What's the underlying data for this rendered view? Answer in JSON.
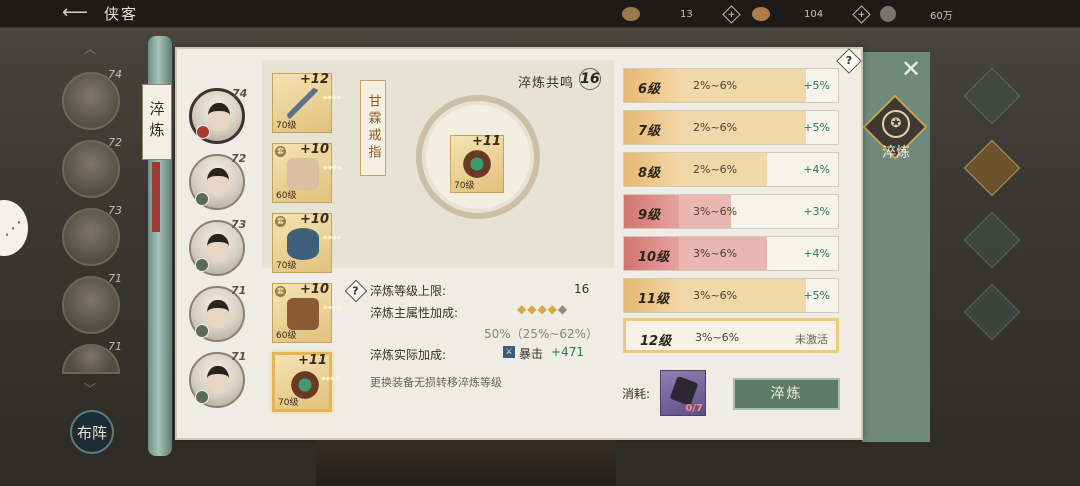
{
  "header": {
    "back_icon": "back-arrow-icon",
    "title": "侠客",
    "resources": [
      {
        "icon": "leaf-icon",
        "value": "13"
      },
      {
        "icon": "hat-icon",
        "value": "104"
      },
      {
        "icon": "coin-icon",
        "value": "60万"
      }
    ]
  },
  "side_tab": {
    "label": "淬炼"
  },
  "close_icon": "close-icon",
  "heroes": [
    {
      "level": "74",
      "selected": true
    },
    {
      "level": "72",
      "selected": false
    },
    {
      "level": "73",
      "selected": false
    },
    {
      "level": "71",
      "selected": false
    },
    {
      "level": "71",
      "selected": false
    }
  ],
  "roster": [
    {
      "level": "74"
    },
    {
      "level": "72"
    },
    {
      "level": "73"
    },
    {
      "level": "71"
    },
    {
      "level": "71"
    }
  ],
  "equipment": [
    {
      "plus": "+12",
      "level": "70级",
      "type": "",
      "color": "#5b6f8f"
    },
    {
      "plus": "+10",
      "level": "60级",
      "type": "套",
      "color": "#d8c1a0"
    },
    {
      "plus": "+10",
      "level": "70级",
      "type": "套",
      "color": "#3f5e7a"
    },
    {
      "plus": "+10",
      "level": "60级",
      "type": "套",
      "color": "#8a5a33"
    },
    {
      "plus": "+11",
      "level": "70级",
      "type": "",
      "color": "#6b3a25"
    }
  ],
  "item": {
    "name": "甘霖戒指",
    "plus": "+11",
    "level": "70级"
  },
  "resonance": {
    "label": "淬炼共鸣",
    "value": "16"
  },
  "stats": {
    "max_level_label": "淬炼等级上限:",
    "max_level_value": "16",
    "main_bonus_label": "淬炼主属性加成:",
    "stars_filled": "◆◆◆◆",
    "stars_empty": "◆",
    "main_bonus_value": "50%（25%~62%）",
    "actual_bonus_label": "淬炼实际加成:",
    "crit_label": "暴击",
    "crit_value": "+471",
    "note": "更换装备无损转移淬炼等级"
  },
  "levels": [
    {
      "name": "6级",
      "range": "2%~6%",
      "bonus": "+5%",
      "style": "gold",
      "fill": 0.85
    },
    {
      "name": "7级",
      "range": "2%~6%",
      "bonus": "+5%",
      "style": "gold",
      "fill": 0.85
    },
    {
      "name": "8级",
      "range": "2%~6%",
      "bonus": "+4%",
      "style": "gold",
      "fill": 0.67
    },
    {
      "name": "9级",
      "range": "3%~6%",
      "bonus": "+3%",
      "style": "red",
      "fill": 0.5
    },
    {
      "name": "10级",
      "range": "3%~6%",
      "bonus": "+4%",
      "style": "red",
      "fill": 0.67
    },
    {
      "name": "11级",
      "range": "3%~6%",
      "bonus": "+5%",
      "style": "gold",
      "fill": 0.85
    },
    {
      "name": "12级",
      "range": "3%~6%",
      "bonus": "未激活",
      "style": "inactive",
      "fill": 0
    }
  ],
  "cost": {
    "label": "消耗:",
    "count": "0/7"
  },
  "forge_button": "淬炼",
  "right_tab_label": "淬炼",
  "layout_button": "布阵"
}
